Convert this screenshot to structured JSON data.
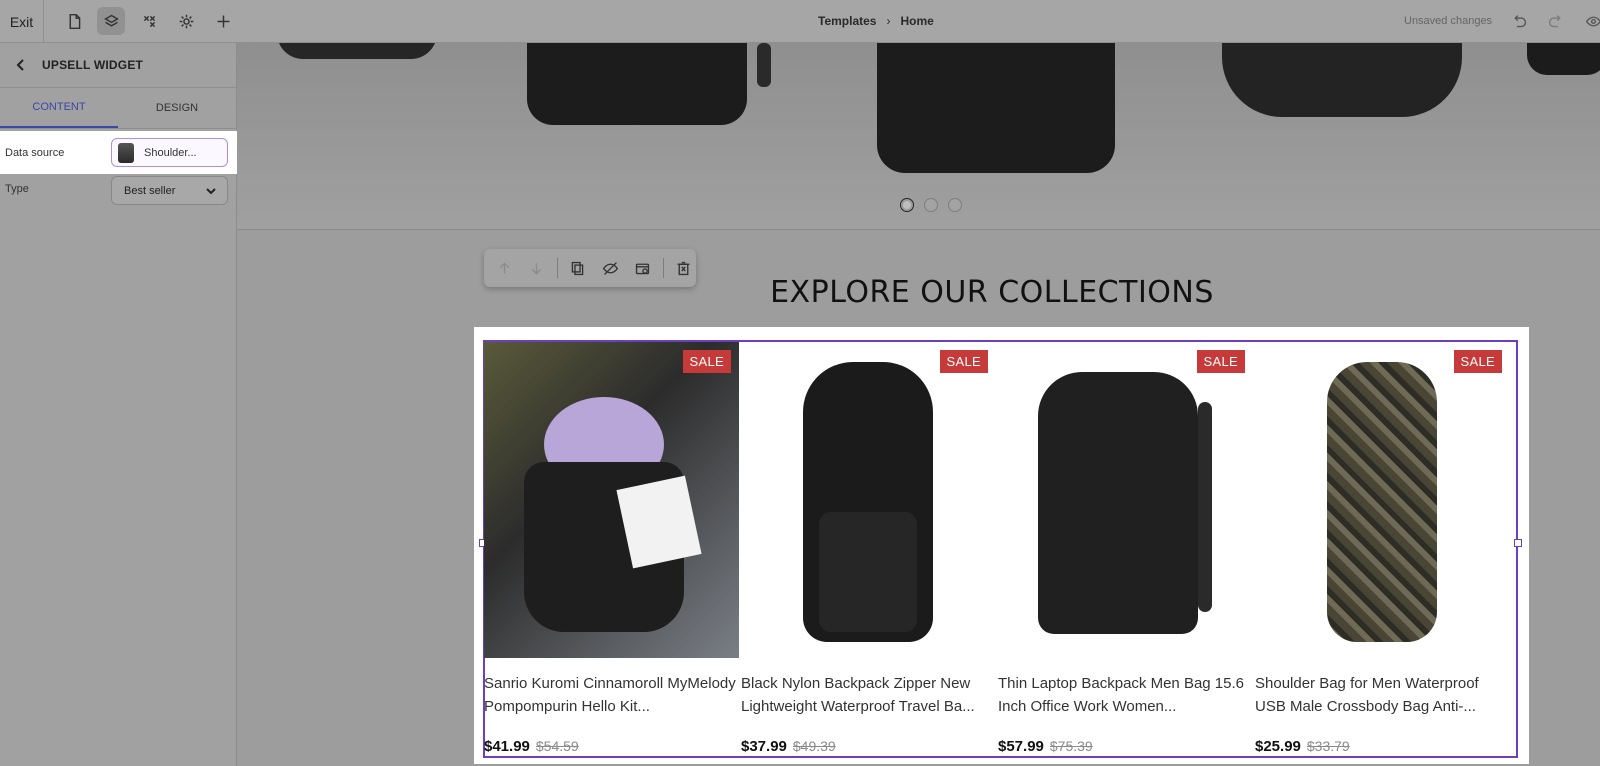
{
  "topbar": {
    "exit_label": "Exit",
    "breadcrumb": [
      "Templates",
      "Home"
    ],
    "status": "Unsaved changes"
  },
  "panel": {
    "title": "UPSELL WIDGET",
    "tabs": [
      "CONTENT",
      "DESIGN"
    ],
    "data_source_label": "Data source",
    "data_source_value": "Shoulder...",
    "type_label": "Type",
    "type_value": "Best seller"
  },
  "canvas": {
    "section_title": "EXPLORE OUR COLLECTIONS",
    "slider_dots": 3,
    "active_dot": 1
  },
  "products": [
    {
      "name": "Sanrio Kuromi Cinnamoroll MyMelody Pompompurin Hello Kit...",
      "price": "$41.99",
      "old_price": "$54.59",
      "badge": "SALE"
    },
    {
      "name": "Black Nylon Backpack Zipper New Lightweight Waterproof Travel Ba...",
      "price": "$37.99",
      "old_price": "$49.39",
      "badge": "SALE"
    },
    {
      "name": "Thin Laptop Backpack Men Bag 15.6 Inch Office Work Women...",
      "price": "$57.99",
      "old_price": "$75.39",
      "badge": "SALE"
    },
    {
      "name": "Shoulder Bag for Men Waterproof USB Male Crossbody Bag Anti-...",
      "price": "$25.99",
      "old_price": "$33.79",
      "badge": "SALE"
    }
  ],
  "colors": {
    "accent": "#3a48a8",
    "selection": "#6a3fc1",
    "sale_badge": "#c73a3a"
  }
}
